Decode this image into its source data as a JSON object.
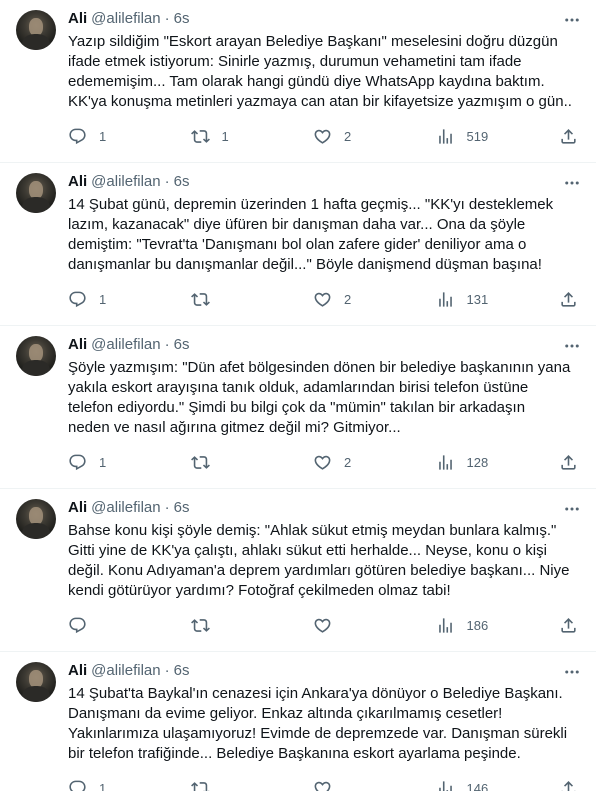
{
  "tweets": [
    {
      "name": "Ali",
      "handle": "@alilefilan",
      "time": "6s",
      "text": "Yazıp sildiğim \"Eskort arayan Belediye Başkanı\" meselesini doğru düzgün\nifade etmek istiyorum: Sinirle yazmış, durumun vehametini tam ifade\nedememişim... Tam olarak hangi gündü diye WhatsApp kaydına baktım.\nKK'ya konuşma metinleri yazmaya can atan bir kifayetsize yazmışım o gün..",
      "replies": "1",
      "retweets": "1",
      "likes": "2",
      "views": "519"
    },
    {
      "name": "Ali",
      "handle": "@alilefilan",
      "time": "6s",
      "text": "14 Şubat günü, depremin üzerinden 1 hafta geçmiş... \"KK'yı desteklemek\nlazım, kazanacak\" diye üfüren bir danışman daha var... Ona da şöyle\ndemiştim: \"Tevrat'ta 'Danışmanı bol olan zafere gider' deniliyor ama o\ndanışmanlar bu danışmanlar değil...\" Böyle danişmend düşman başına!",
      "replies": "1",
      "retweets": "",
      "likes": "2",
      "views": "131"
    },
    {
      "name": "Ali",
      "handle": "@alilefilan",
      "time": "6s",
      "text": "Şöyle yazmışım: \"Dün afet bölgesinden dönen bir belediye başkanının yana\nyakıla eskort arayışına tanık olduk, adamlarından birisi telefon üstüne\ntelefon ediyordu.\" Şimdi bu bilgi çok da \"mümin\" takılan bir arkadaşın\nneden ve nasıl ağırına gitmez değil mi? Gitmiyor...",
      "replies": "1",
      "retweets": "",
      "likes": "2",
      "views": "128"
    },
    {
      "name": "Ali",
      "handle": "@alilefilan",
      "time": "6s",
      "text": "Bahse konu kişi şöyle demiş: \"Ahlak sükut etmiş meydan bunlara kalmış.\"\nGitti yine de KK'ya çalıştı, ahlakı sükut etti herhalde... Neyse, konu o kişi\ndeğil. Konu Adıyaman'a deprem yardımları götüren belediye başkanı... Niye\nkendi götürüyor yardımı? Fotoğraf çekilmeden olmaz tabi!",
      "replies": "",
      "retweets": "",
      "likes": "",
      "views": "186"
    },
    {
      "name": "Ali",
      "handle": "@alilefilan",
      "time": "6s",
      "text": "14 Şubat'ta Baykal'ın cenazesi için Ankara'ya dönüyor o Belediye Başkanı.\nDanışmanı da evime geliyor. Enkaz altında çıkarılmamış cesetler!\nYakınlarımıza ulaşamıyoruz! Evimde de depremzede var. Danışman sürekli\nbir telefon trafiğinde... Belediye Başkanına eskort ayarlama peşinde.",
      "replies": "1",
      "retweets": "",
      "likes": "",
      "views": "146"
    }
  ],
  "icons": {
    "more": "more-horizontal-icon",
    "reply": "reply-icon",
    "retweet": "retweet-icon",
    "like": "heart-icon",
    "views": "views-chart-icon",
    "share": "share-icon"
  },
  "colors": {
    "text": "#0f1419",
    "secondary": "#536471",
    "divider": "#eff3f4"
  }
}
